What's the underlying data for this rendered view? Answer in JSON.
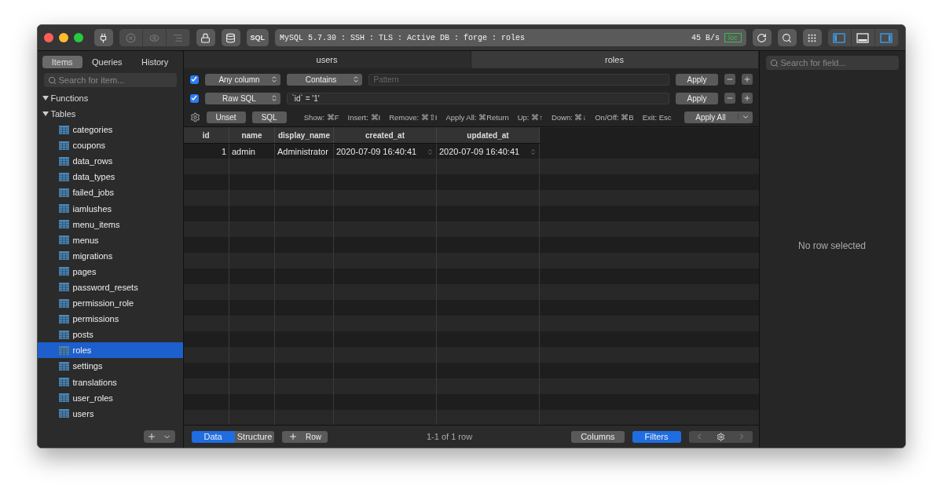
{
  "toolbar": {
    "sql_button": "SQL",
    "connection": "MySQL 5.7.30 : SSH : TLS : Active DB : forge : roles",
    "rate": "45 B/s",
    "badge": "loc"
  },
  "sidebar": {
    "tabs": [
      {
        "label": "Items",
        "selected": true
      },
      {
        "label": "Queries",
        "selected": false
      },
      {
        "label": "History",
        "selected": false
      }
    ],
    "search": {
      "placeholder": "Search for item..."
    },
    "tree": [
      {
        "label": "Functions",
        "expanded": true
      },
      {
        "label": "Tables",
        "expanded": true,
        "children": [
          {
            "label": "categories",
            "selected": false
          },
          {
            "label": "coupons",
            "selected": false
          },
          {
            "label": "data_rows",
            "selected": false
          },
          {
            "label": "data_types",
            "selected": false
          },
          {
            "label": "failed_jobs",
            "selected": false
          },
          {
            "label": "iamlushes",
            "selected": false
          },
          {
            "label": "menu_items",
            "selected": false
          },
          {
            "label": "menus",
            "selected": false
          },
          {
            "label": "migrations",
            "selected": false
          },
          {
            "label": "pages",
            "selected": false
          },
          {
            "label": "password_resets",
            "selected": false
          },
          {
            "label": "permission_role",
            "selected": false
          },
          {
            "label": "permissions",
            "selected": false
          },
          {
            "label": "posts",
            "selected": false
          },
          {
            "label": "roles",
            "selected": true
          },
          {
            "label": "settings",
            "selected": false
          },
          {
            "label": "translations",
            "selected": false
          },
          {
            "label": "user_roles",
            "selected": false
          },
          {
            "label": "users",
            "selected": false
          }
        ]
      }
    ]
  },
  "tabs": [
    {
      "label": "users",
      "selected": false
    },
    {
      "label": "roles",
      "selected": true
    }
  ],
  "filters": [
    {
      "checked": true,
      "column": "Any column",
      "operator": "Contains",
      "placeholder": "Pattern",
      "apply": "Apply"
    },
    {
      "checked": true,
      "column": "Raw SQL",
      "value": "`id` = '1'",
      "apply": "Apply"
    }
  ],
  "filter_bar": {
    "buttons": [
      "Unset",
      "SQL"
    ],
    "shortcuts": [
      "Show: ⌘F",
      "Insert: ⌘I",
      "Remove: ⌘⇧I",
      "Apply All: ⌘Return",
      "Up: ⌘↑",
      "Down: ⌘↓",
      "On/Off: ⌘B",
      "Exit: Esc"
    ],
    "apply_all": "Apply All"
  },
  "table": {
    "columns": [
      "id",
      "name",
      "display_name",
      "created_at",
      "updated_at"
    ],
    "rows": [
      [
        "1",
        "admin",
        "Administrator",
        "2020-07-09 16:40:41",
        "2020-07-09 16:40:41"
      ]
    ]
  },
  "bottom_bar": {
    "views": [
      {
        "label": "Data",
        "selected": true
      },
      {
        "label": "Structure",
        "selected": false
      }
    ],
    "add_row": "Row",
    "count": "1-1 of 1 row",
    "columns_button": "Columns",
    "filters_button": {
      "label": "Filters",
      "on": true
    }
  },
  "details": {
    "search": {
      "placeholder": "Search for field..."
    },
    "empty": "No row selected"
  }
}
